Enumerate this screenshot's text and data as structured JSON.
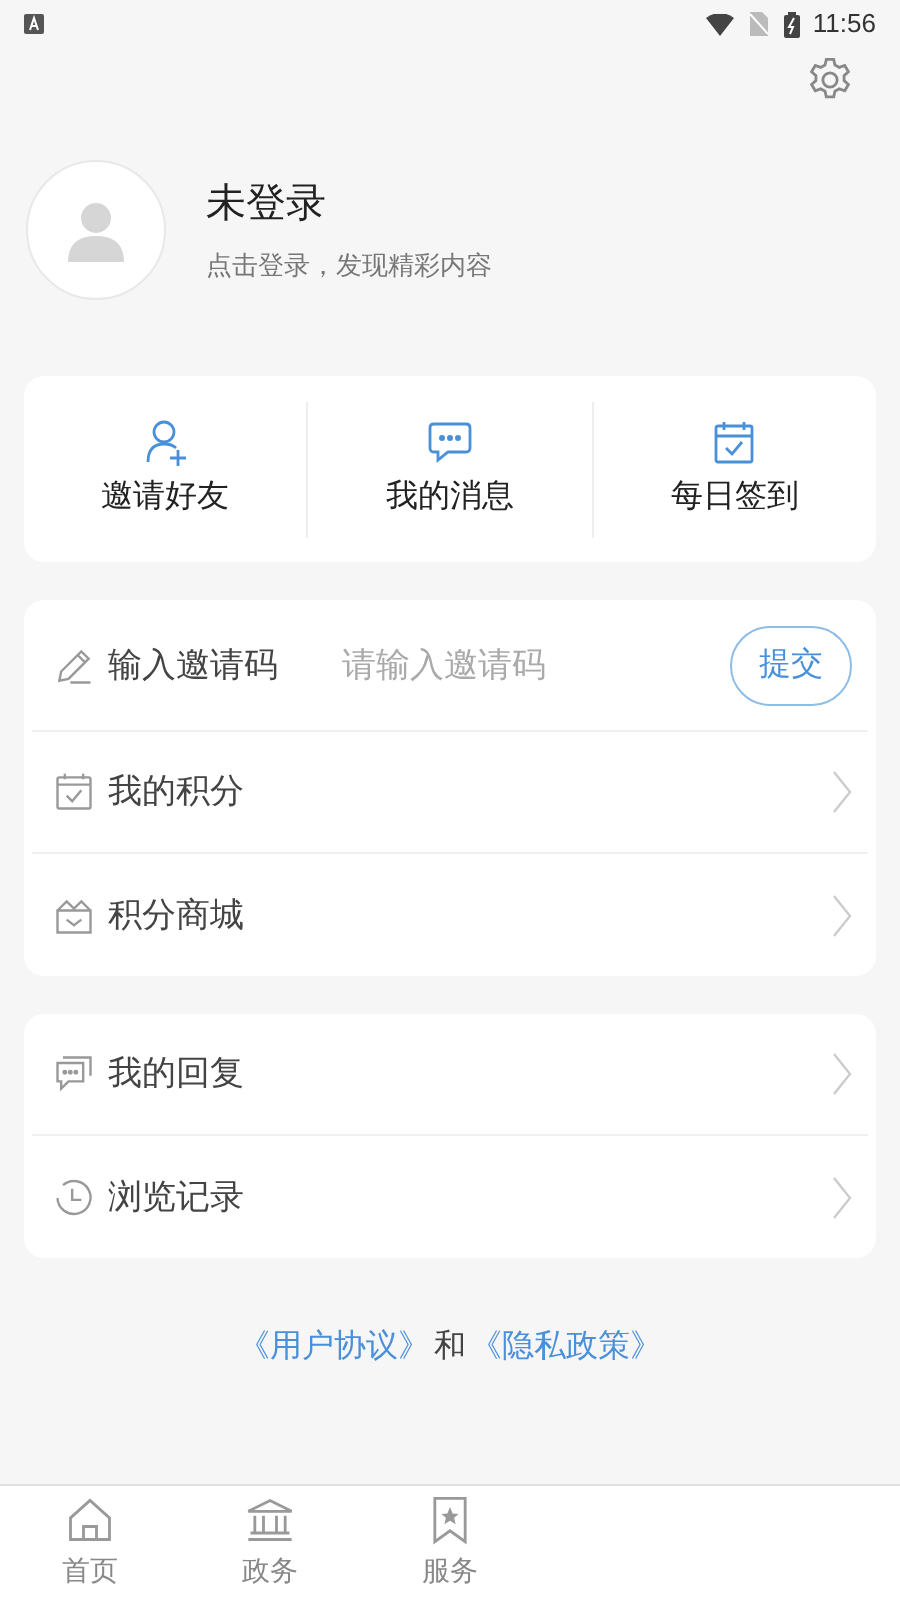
{
  "status_bar": {
    "time": "11:56"
  },
  "profile": {
    "name": "未登录",
    "hint": "点击登录，发现精彩内容"
  },
  "quick_actions": [
    {
      "kind": "invite",
      "label": "邀请好友"
    },
    {
      "kind": "messages",
      "label": "我的消息"
    },
    {
      "kind": "checkin",
      "label": "每日签到"
    }
  ],
  "invite_code": {
    "label": "输入邀请码",
    "placeholder": "请输入邀请码",
    "button": "提交"
  },
  "menu_group_1": [
    {
      "kind": "points",
      "label": "我的积分"
    },
    {
      "kind": "shop",
      "label": "积分商城"
    }
  ],
  "menu_group_2": [
    {
      "kind": "replies",
      "label": "我的回复"
    },
    {
      "kind": "history",
      "label": "浏览记录"
    }
  ],
  "agreement": {
    "user_agreement": "《用户协议》",
    "joiner": "和",
    "privacy_policy": "《隐私政策》"
  },
  "bottom_nav": [
    {
      "kind": "home",
      "label": "首页",
      "selected": false
    },
    {
      "kind": "gov",
      "label": "政务",
      "selected": false
    },
    {
      "kind": "service",
      "label": "服务",
      "selected": false
    }
  ]
}
